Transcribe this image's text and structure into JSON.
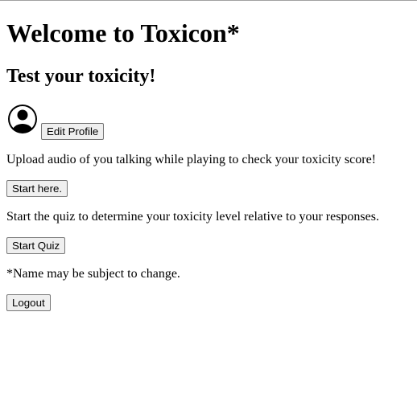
{
  "header": {
    "title": "Welcome to Toxicon*",
    "subtitle": "Test your toxicity!"
  },
  "profile": {
    "avatar_icon": "user-avatar-icon",
    "edit_label": "Edit Profile"
  },
  "audio_section": {
    "description": "Upload audio of you talking while playing to check your toxicity score!",
    "button_label": "Start here."
  },
  "quiz_section": {
    "description": "Start the quiz to determine your toxicity level relative to your responses.",
    "button_label": "Start Quiz"
  },
  "footnote": "*Name may be subject to change.",
  "logout_label": "Logout"
}
